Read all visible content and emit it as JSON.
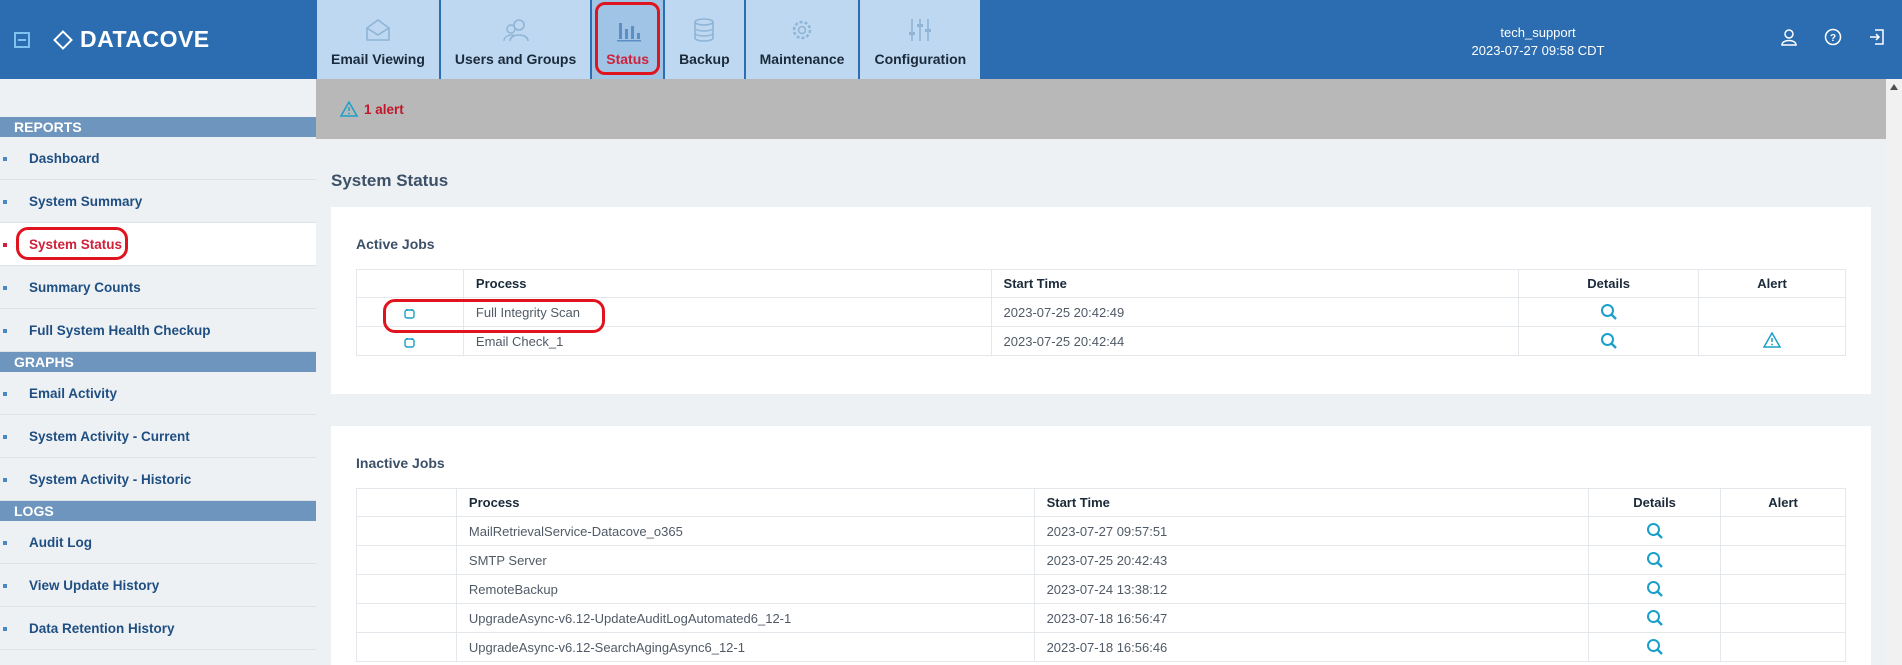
{
  "brand": {
    "name": "DATACOVE"
  },
  "tabs": [
    {
      "label": "Email Viewing",
      "icon": "envelope-icon"
    },
    {
      "label": "Users and Groups",
      "icon": "users-icon"
    },
    {
      "label": "Status",
      "icon": "bar-chart-icon",
      "active": true
    },
    {
      "label": "Backup",
      "icon": "database-icon"
    },
    {
      "label": "Maintenance",
      "icon": "gear-icon"
    },
    {
      "label": "Configuration",
      "icon": "sliders-icon"
    }
  ],
  "user": {
    "name": "tech_support",
    "datetime": "2023-07-27 09:58 CDT"
  },
  "sidebar": {
    "reports_header": "REPORTS",
    "reports": [
      "Dashboard",
      "System Summary",
      "System Status",
      "Summary Counts",
      "Full System Health Checkup"
    ],
    "graphs_header": "GRAPHS",
    "graphs": [
      "Email Activity",
      "System Activity - Current",
      "System Activity - Historic"
    ],
    "logs_header": "LOGS",
    "logs": [
      "Audit Log",
      "View Update History",
      "Data Retention History"
    ]
  },
  "alert": {
    "text": "1 alert"
  },
  "page": {
    "title": "System Status"
  },
  "active_jobs": {
    "title": "Active Jobs",
    "columns": {
      "process": "Process",
      "start": "Start Time",
      "details": "Details",
      "alert": "Alert"
    },
    "rows": [
      {
        "process": "Full Integrity Scan",
        "start": "2023-07-25 20:42:49"
      },
      {
        "process": "Email Check_1",
        "start": "2023-07-25 20:42:44"
      }
    ]
  },
  "inactive_jobs": {
    "title": "Inactive Jobs",
    "columns": {
      "process": "Process",
      "start": "Start Time",
      "details": "Details",
      "alert": "Alert"
    },
    "rows": [
      {
        "process": "MailRetrievalService-Datacove_o365",
        "start": "2023-07-27 09:57:51"
      },
      {
        "process": "SMTP Server",
        "start": "2023-07-25 20:42:43"
      },
      {
        "process": "RemoteBackup",
        "start": "2023-07-24 13:38:12"
      },
      {
        "process": "UpgradeAsync-v6.12-UpdateAuditLogAutomated6_12-1",
        "start": "2023-07-18 16:56:47"
      },
      {
        "process": "UpgradeAsync-v6.12-SearchAgingAsync6_12-1",
        "start": "2023-07-18 16:56:46"
      }
    ]
  },
  "colors": {
    "topbar": "#2b6db0",
    "accent": "#1a9fc9",
    "alert": "#d0213a"
  }
}
